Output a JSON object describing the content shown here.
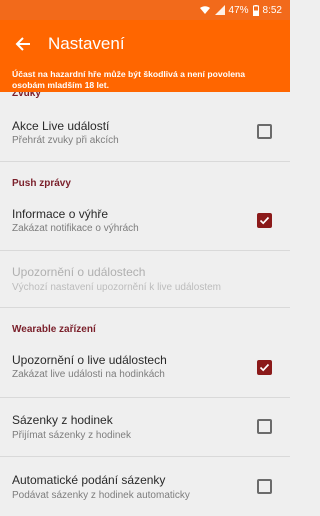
{
  "status_bar": {
    "battery": "47%",
    "time": "8:52"
  },
  "app_bar": {
    "title": "Nastavení"
  },
  "warning": "Účast na hazardní hře může být škodlivá a není povolena osobám mladším 18 let.",
  "sections": {
    "sounds": {
      "header": "Zvuky",
      "live_events": {
        "title": "Akce Live událostí",
        "subtitle": "Přehrát zvuky při akcích",
        "checked": false
      }
    },
    "push": {
      "header": "Push zprávy",
      "win_info": {
        "title": "Informace o výhře",
        "subtitle": "Zakázat notifikace o výhrách",
        "checked": true
      },
      "event_alerts": {
        "title": "Upozornění o událostech",
        "subtitle": "Výchozí nastavení upozornění k live událostem"
      }
    },
    "wearable": {
      "header": "Wearable zařízení",
      "live_alerts": {
        "title": "Upozornění o live událostech",
        "subtitle": "Zakázat live události na hodinkách",
        "checked": true
      },
      "watch_bets": {
        "title": "Sázenky z hodinek",
        "subtitle": "Přijímat sázenky z hodinek",
        "checked": false
      },
      "auto_submit": {
        "title": "Automatické podání sázenky",
        "subtitle": "Podávat sázenky z hodinek automaticky",
        "checked": false
      }
    }
  },
  "colors": {
    "accent": "#ff6600",
    "checkbox": "#8b1a1a",
    "section_header": "#7a1f2a"
  }
}
